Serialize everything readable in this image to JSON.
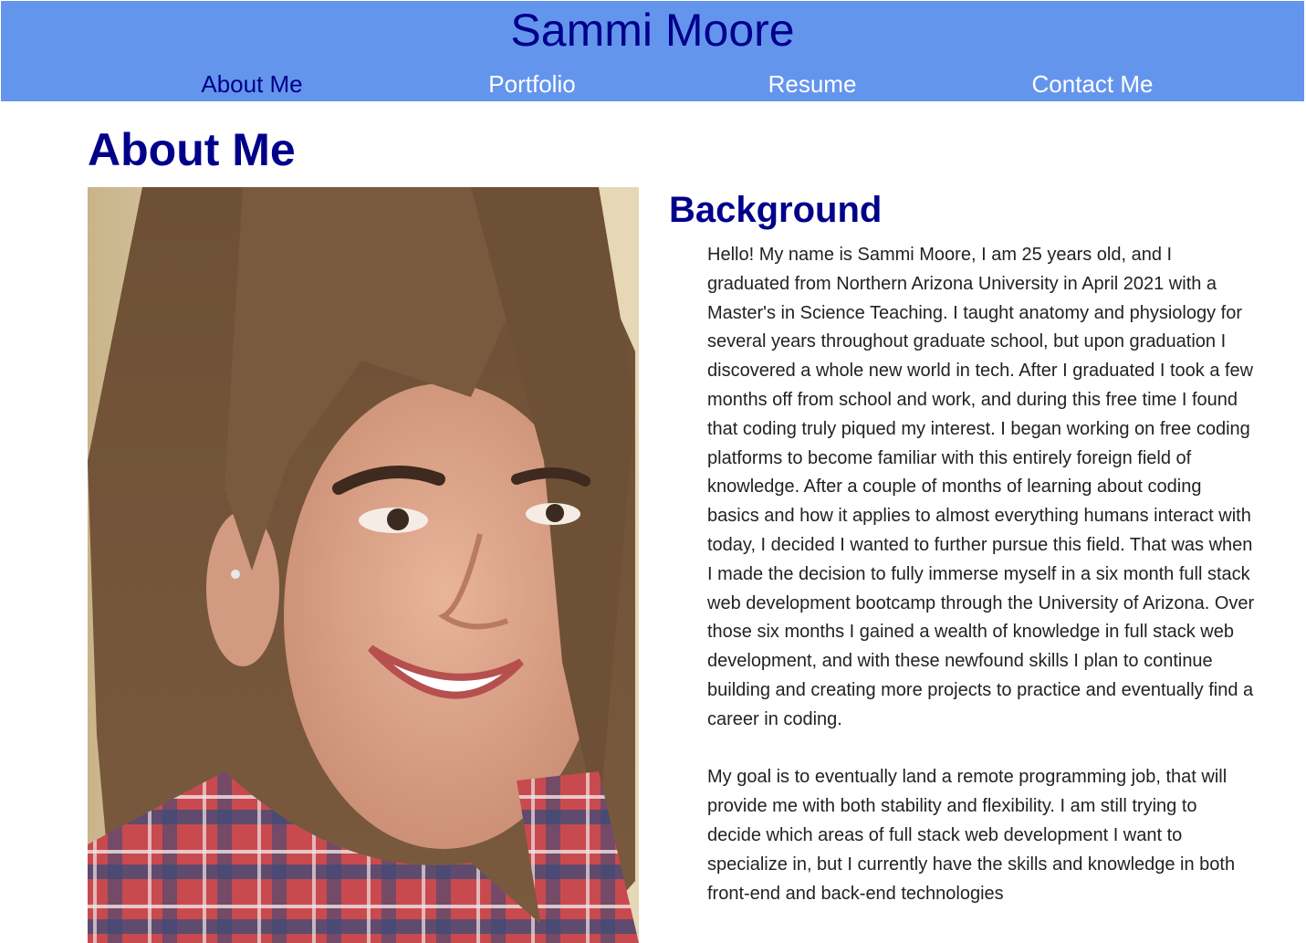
{
  "site": {
    "title": "Sammi Moore"
  },
  "nav": {
    "items": [
      {
        "label": "About Me",
        "active": true
      },
      {
        "label": "Portfolio",
        "active": false
      },
      {
        "label": "Resume",
        "active": false
      },
      {
        "label": "Contact Me",
        "active": false
      }
    ]
  },
  "about": {
    "title": "About Me",
    "background_heading": "Background",
    "paragraphs": [
      "Hello! My name is Sammi Moore, I am 25 years old, and I graduated from Northern Arizona University in April 2021 with a Master's in Science Teaching. I taught anatomy and physiology for several years throughout graduate school, but upon graduation I discovered a whole new world in tech. After I graduated I took a few months off from school and work, and during this free time I found that coding truly piqued my interest. I began working on free coding platforms to become familiar with this entirely foreign field of knowledge. After a couple of months of learning about coding basics and how it applies to almost everything humans interact with today, I decided I wanted to further pursue this field. That was when I made the decision to fully immerse myself in a six month full stack web development bootcamp through the University of Arizona. Over those six months I gained a wealth of knowledge in full stack web development, and with these newfound skills I plan to continue building and creating more projects to practice and eventually find a career in coding.",
      "My goal is to eventually land a remote programming job, that will provide me with both stability and flexibility. I am still trying to decide which areas of full stack web development I want to specialize in, but I currently have the skills and knowledge in both front-end and back-end technologies"
    ]
  },
  "colors": {
    "header_bg": "#6495ed",
    "title_color": "#00008b",
    "nav_inactive": "#ffffff",
    "body_text": "#222222"
  }
}
